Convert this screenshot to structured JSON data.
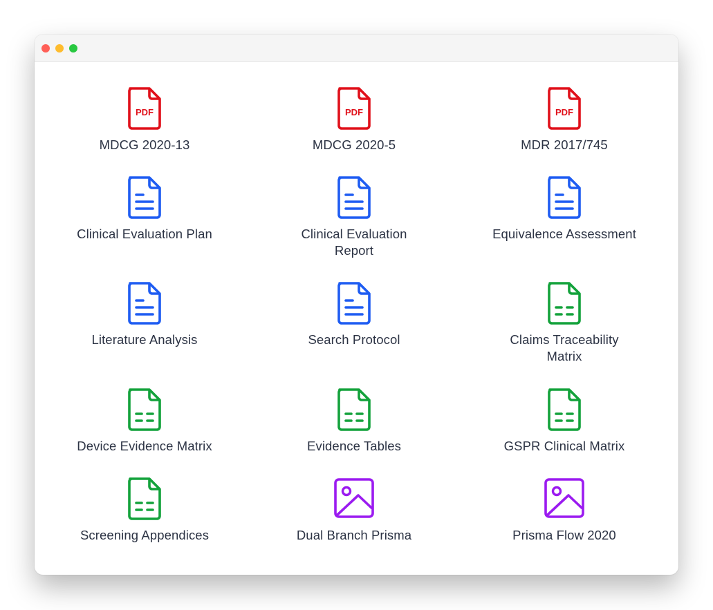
{
  "colors": {
    "pdf": "#e0101a",
    "doc": "#1e5cf2",
    "sheet": "#13a23b",
    "image": "#9b1bf0",
    "label": "#2c3344"
  },
  "files": [
    {
      "label": "MDCG 2020-13",
      "icon": "pdf-icon",
      "icon_text": "PDF"
    },
    {
      "label": "MDCG 2020-5",
      "icon": "pdf-icon",
      "icon_text": "PDF"
    },
    {
      "label": "MDR 2017/745",
      "icon": "pdf-icon",
      "icon_text": "PDF"
    },
    {
      "label": "Clinical Evaluation Plan",
      "icon": "document-icon"
    },
    {
      "label": "Clinical Evaluation Report",
      "icon": "document-icon"
    },
    {
      "label": "Equivalence Assessment",
      "icon": "document-icon"
    },
    {
      "label": "Literature Analysis",
      "icon": "document-icon"
    },
    {
      "label": "Search Protocol",
      "icon": "document-icon"
    },
    {
      "label": "Claims Traceability Matrix",
      "icon": "spreadsheet-icon"
    },
    {
      "label": "Device Evidence Matrix",
      "icon": "spreadsheet-icon"
    },
    {
      "label": "Evidence Tables",
      "icon": "spreadsheet-icon"
    },
    {
      "label": "GSPR Clinical Matrix",
      "icon": "spreadsheet-icon"
    },
    {
      "label": "Screening Appendices",
      "icon": "spreadsheet-icon"
    },
    {
      "label": "Dual Branch Prisma",
      "icon": "image-icon"
    },
    {
      "label": "Prisma Flow 2020",
      "icon": "image-icon"
    }
  ]
}
